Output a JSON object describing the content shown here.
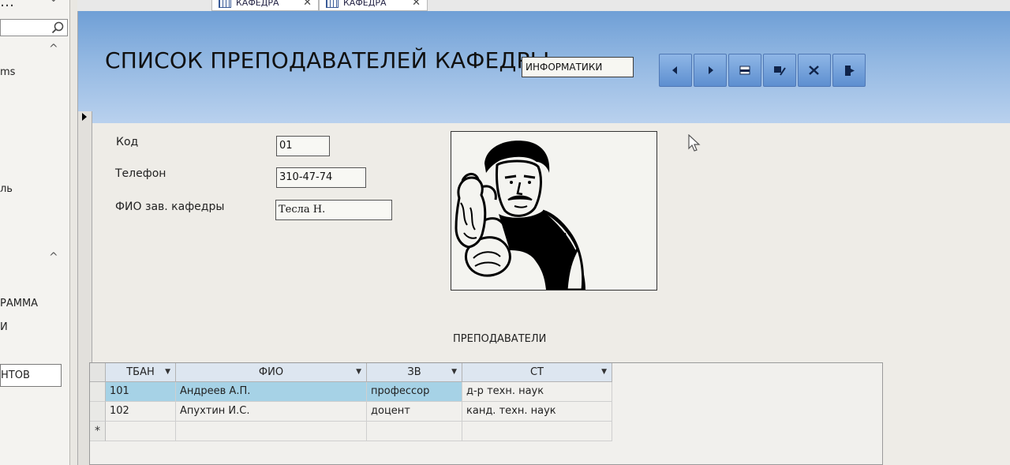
{
  "nav": {
    "items": [
      "ms",
      "ль",
      "РАММА",
      "И"
    ],
    "selected_item": "НТОВ"
  },
  "tabs": [
    {
      "label": "КАФЕДРА"
    },
    {
      "label": "КАФЕДРА"
    }
  ],
  "form": {
    "title": "СПИСОК ПРЕПОДАВАТЕЛЕЙ КАФЕДРЫ",
    "department": "ИНФОРМАТИКИ",
    "nav_buttons": [
      {
        "icon": "previous-record-icon"
      },
      {
        "icon": "next-record-icon"
      },
      {
        "icon": "new-record-icon"
      },
      {
        "icon": "edit-record-icon"
      },
      {
        "icon": "delete-record-icon"
      },
      {
        "icon": "exit-form-icon"
      }
    ],
    "fields": {
      "code_label": "Код",
      "code_value": "01",
      "phone_label": "Телефон",
      "phone_value": "310-47-74",
      "head_label": "ФИО зав. кафедры",
      "head_value": "Тесла Н."
    },
    "subform": {
      "label": "ПРЕПОДАВАТЕЛИ",
      "columns": [
        "ТБАН",
        "ФИО",
        "ЗВ",
        "СТ"
      ],
      "rows": [
        [
          "101",
          "Андреев А.П.",
          "профессор",
          "д-р техн. наук"
        ],
        [
          "102",
          "Апухтин И.С.",
          "доцент",
          "канд. техн. наук"
        ]
      ],
      "new_row_marker": "*"
    }
  },
  "colors": {
    "header_gradient_top": "#6f9fd6",
    "button_blue": "#5d8fd0",
    "selected_row": "#a6d2e6"
  }
}
